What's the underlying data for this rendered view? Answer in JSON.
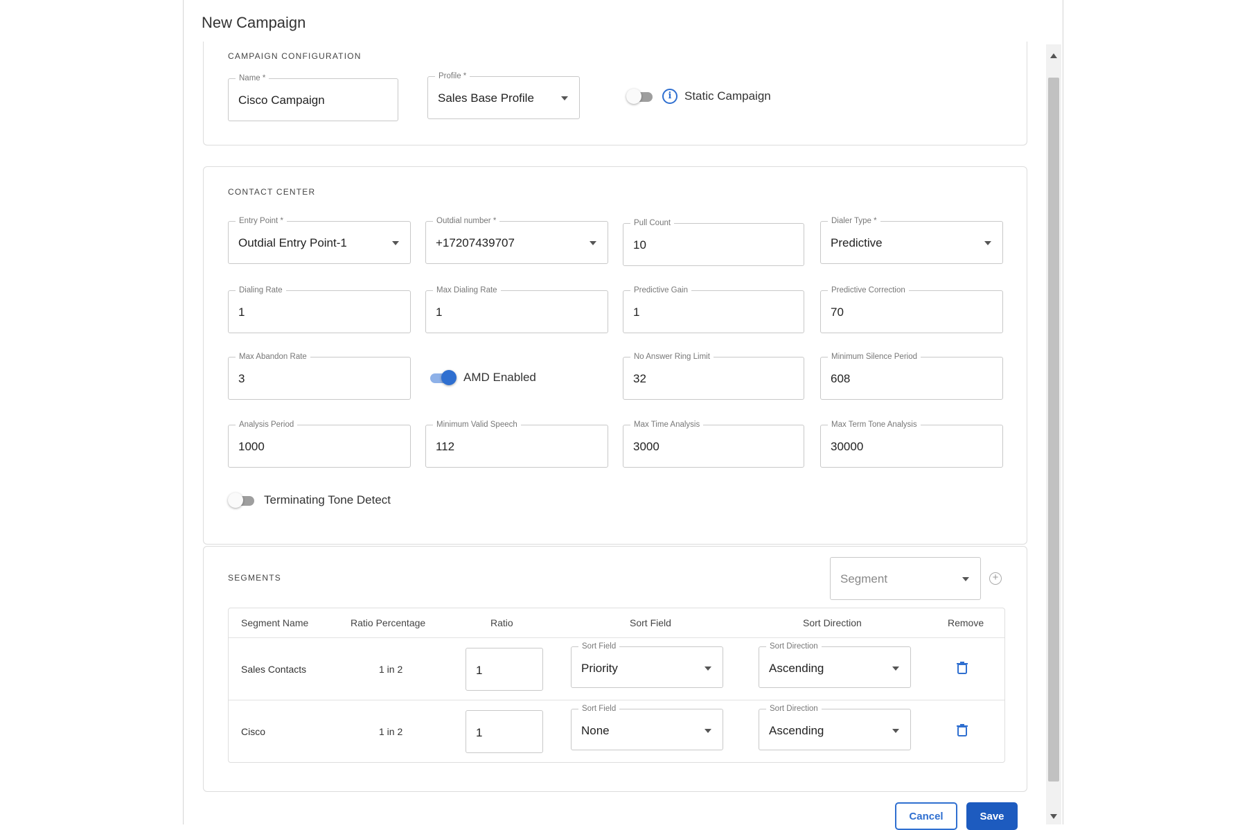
{
  "dialog": {
    "title": "New Campaign"
  },
  "campaign_config": {
    "section_title": "CAMPAIGN CONFIGURATION",
    "name": {
      "label": "Name *",
      "value": "Cisco Campaign"
    },
    "profile": {
      "label": "Profile *",
      "value": "Sales Base Profile"
    },
    "static_campaign": {
      "label": "Static Campaign",
      "enabled": false
    }
  },
  "contact_center": {
    "section_title": "CONTACT CENTER",
    "entry_point": {
      "label": "Entry Point *",
      "value": "Outdial Entry Point-1"
    },
    "outdial_number": {
      "label": "Outdial number *",
      "value": "+17207439707"
    },
    "pull_count": {
      "label": "Pull Count",
      "value": "10"
    },
    "dialer_type": {
      "label": "Dialer Type *",
      "value": "Predictive"
    },
    "dialing_rate": {
      "label": "Dialing Rate",
      "value": "1"
    },
    "max_dialing_rate": {
      "label": "Max Dialing Rate",
      "value": "1"
    },
    "predictive_gain": {
      "label": "Predictive Gain",
      "value": "1"
    },
    "predictive_correction": {
      "label": "Predictive Correction",
      "value": "70"
    },
    "max_abandon_rate": {
      "label": "Max Abandon Rate",
      "value": "3"
    },
    "amd_enabled": {
      "label": "AMD Enabled",
      "enabled": true
    },
    "no_answer_ring_limit": {
      "label": "No Answer Ring Limit",
      "value": "32"
    },
    "minimum_silence_period": {
      "label": "Minimum Silence Period",
      "value": "608"
    },
    "analysis_period": {
      "label": "Analysis Period",
      "value": "1000"
    },
    "minimum_valid_speech": {
      "label": "Minimum Valid Speech",
      "value": "112"
    },
    "max_time_analysis": {
      "label": "Max Time Analysis",
      "value": "3000"
    },
    "max_term_tone_analysis": {
      "label": "Max Term Tone Analysis",
      "value": "30000"
    },
    "terminating_tone_detect": {
      "label": "Terminating Tone Detect",
      "enabled": false
    }
  },
  "segments": {
    "section_title": "SEGMENTS",
    "segment_select": {
      "placeholder": "Segment"
    },
    "columns": [
      "Segment Name",
      "Ratio Percentage",
      "Ratio",
      "Sort Field",
      "Sort Direction",
      "Remove"
    ],
    "sort_field_label": "Sort Field",
    "sort_direction_label": "Sort Direction",
    "rows": [
      {
        "name": "Sales Contacts",
        "ratio_percentage": "1 in 2",
        "ratio": "1",
        "sort_field": "Priority",
        "sort_direction": "Ascending"
      },
      {
        "name": "Cisco",
        "ratio_percentage": "1 in 2",
        "ratio": "1",
        "sort_field": "None",
        "sort_direction": "Ascending"
      }
    ]
  },
  "footer": {
    "cancel_label": "Cancel",
    "save_label": "Save"
  },
  "colors": {
    "primary": "#2f6fd0",
    "border": "#c8c8c8",
    "scrollbar": "#c1c1c1"
  }
}
